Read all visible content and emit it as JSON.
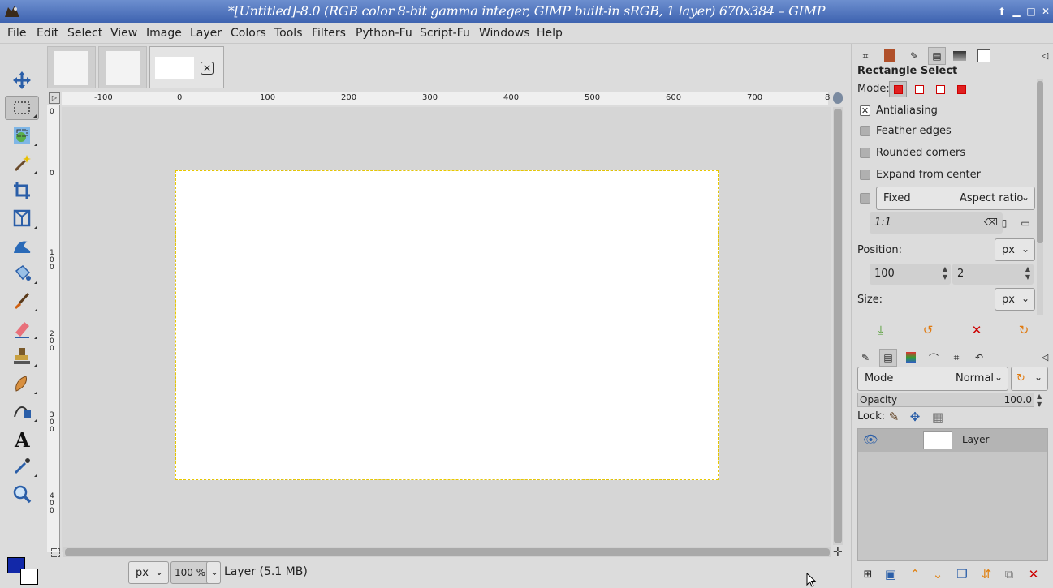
{
  "window": {
    "title": "*[Untitled]-8.0 (RGB color 8-bit gamma integer, GIMP built-in sRGB, 1 layer) 670x384 – GIMP"
  },
  "menu": [
    "File",
    "Edit",
    "Select",
    "View",
    "Image",
    "Layer",
    "Colors",
    "Tools",
    "Filters",
    "Python-Fu",
    "Script-Fu",
    "Windows",
    "Help"
  ],
  "tools": [
    {
      "name": "move-tool-icon"
    },
    {
      "name": "rectangle-select-tool-icon",
      "active": true
    },
    {
      "name": "foreground-select-tool-icon"
    },
    {
      "name": "fuzzy-select-tool-icon"
    },
    {
      "name": "crop-tool-icon"
    },
    {
      "name": "perspective-tool-icon"
    },
    {
      "name": "warp-transform-tool-icon"
    },
    {
      "name": "bucket-fill-tool-icon"
    },
    {
      "name": "paintbrush-tool-icon"
    },
    {
      "name": "eraser-tool-icon"
    },
    {
      "name": "clone-tool-icon"
    },
    {
      "name": "smudge-tool-icon"
    },
    {
      "name": "paths-tool-icon"
    },
    {
      "name": "text-tool-icon"
    },
    {
      "name": "color-picker-tool-icon"
    },
    {
      "name": "zoom-tool-icon"
    }
  ],
  "colors": {
    "foreground": "#1228a8",
    "background": "#ffffff"
  },
  "rulers": {
    "h_labels": [
      "-100",
      "0",
      "100",
      "200",
      "300",
      "400",
      "500",
      "600",
      "700",
      "8"
    ],
    "v_labels": [
      "0",
      "0",
      "100",
      "200",
      "300",
      "400"
    ]
  },
  "statusbar": {
    "unit": "px",
    "zoom": "100 %",
    "message": "Layer (5.1 MB)"
  },
  "tool_options": {
    "title": "Rectangle Select",
    "mode_label": "Mode:",
    "antialiasing": {
      "label": "Antialiasing",
      "checked": true
    },
    "feather_edges": {
      "label": "Feather edges",
      "checked": false
    },
    "rounded_corners": {
      "label": "Rounded corners",
      "checked": false
    },
    "expand_from_center": {
      "label": "Expand from center",
      "checked": false
    },
    "fixed": {
      "label": "Fixed",
      "option": "Aspect ratio",
      "checked": false
    },
    "ratio_value": "1:1",
    "position_label": "Position:",
    "position_unit": "px",
    "position_x": "100",
    "position_y": "2",
    "size_label": "Size:",
    "size_unit": "px"
  },
  "layers": {
    "mode_label": "Mode",
    "mode_value": "Normal",
    "opacity_label": "Opacity",
    "opacity_value": "100.0",
    "lock_label": "Lock:",
    "items": [
      {
        "name": "Layer",
        "visible": true
      }
    ]
  }
}
